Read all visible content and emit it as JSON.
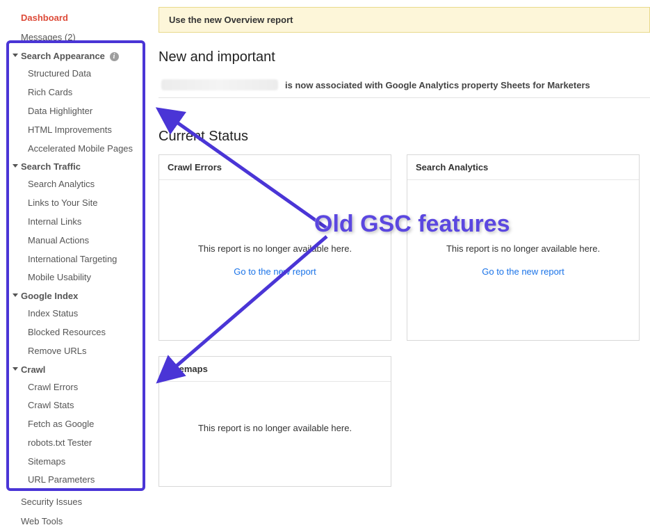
{
  "sidebar": {
    "dashboard": "Dashboard",
    "messages": "Messages (2)",
    "sections": [
      {
        "label": "Search Appearance",
        "info": true,
        "items": [
          "Structured Data",
          "Rich Cards",
          "Data Highlighter",
          "HTML Improvements",
          "Accelerated Mobile Pages"
        ]
      },
      {
        "label": "Search Traffic",
        "items": [
          "Search Analytics",
          "Links to Your Site",
          "Internal Links",
          "Manual Actions",
          "International Targeting",
          "Mobile Usability"
        ]
      },
      {
        "label": "Google Index",
        "items": [
          "Index Status",
          "Blocked Resources",
          "Remove URLs"
        ]
      },
      {
        "label": "Crawl",
        "items": [
          "Crawl Errors",
          "Crawl Stats",
          "Fetch as Google",
          "robots.txt Tester",
          "Sitemaps",
          "URL Parameters"
        ]
      }
    ],
    "security": "Security Issues",
    "webtools": "Web Tools"
  },
  "banner": "Use the new Overview report",
  "new_title": "New and important",
  "assoc_text": "is now associated with Google Analytics property Sheets for Marketers",
  "status_title": "Current Status",
  "cards": {
    "crawl_errors": "Crawl Errors",
    "search_analytics": "Search Analytics",
    "sitemaps": "Sitemaps",
    "unavailable": "This report is no longer available here.",
    "link": "Go to the new report"
  },
  "annotation": "Old GSC features"
}
